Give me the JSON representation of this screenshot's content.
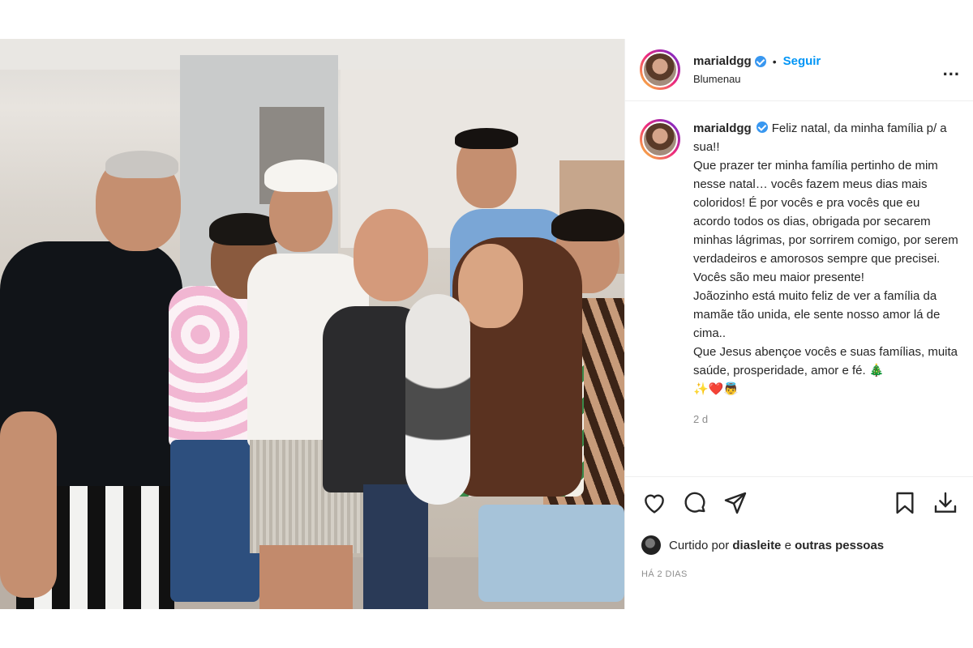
{
  "post": {
    "image_alt": "Foto de família reunida no Natal",
    "author": {
      "username": "marialdgg",
      "follow_label": "Seguir",
      "location": "Blumenau",
      "more_label": "..."
    },
    "caption": {
      "text": "Feliz natal, da minha família p/ a sua!!\nQue prazer ter minha família pertinho de mim nesse natal… vocês fazem meus dias mais coloridos! É por vocês e pra vocês que eu acordo todos os dias, obrigada por secarem minhas lágrimas, por sorrirem comigo, por serem verdadeiros e amorosos sempre que precisei. Vocês são meu maior presente!\nJoãozinho está muito feliz de ver a família da mamãe tão unida, ele sente nosso amor lá de cima..\nQue Jesus abençoe vocês e suas famílias, muita saúde, prosperidade, amor e fé. 🎄\n✨❤️👼",
      "time": "2 d"
    },
    "likes": {
      "prefix": "Curtido por",
      "user": "diasleite",
      "suffix": "e",
      "others": "outras pessoas"
    },
    "date": "HÁ 2 DIAS"
  },
  "icons": {
    "like": "heart-icon",
    "comment": "comment-icon",
    "share": "send-icon",
    "save": "bookmark-icon",
    "download": "download-icon"
  },
  "colors": {
    "accent": "#0095f6",
    "verified": "#3897f0",
    "muted": "#8e8e8e"
  }
}
